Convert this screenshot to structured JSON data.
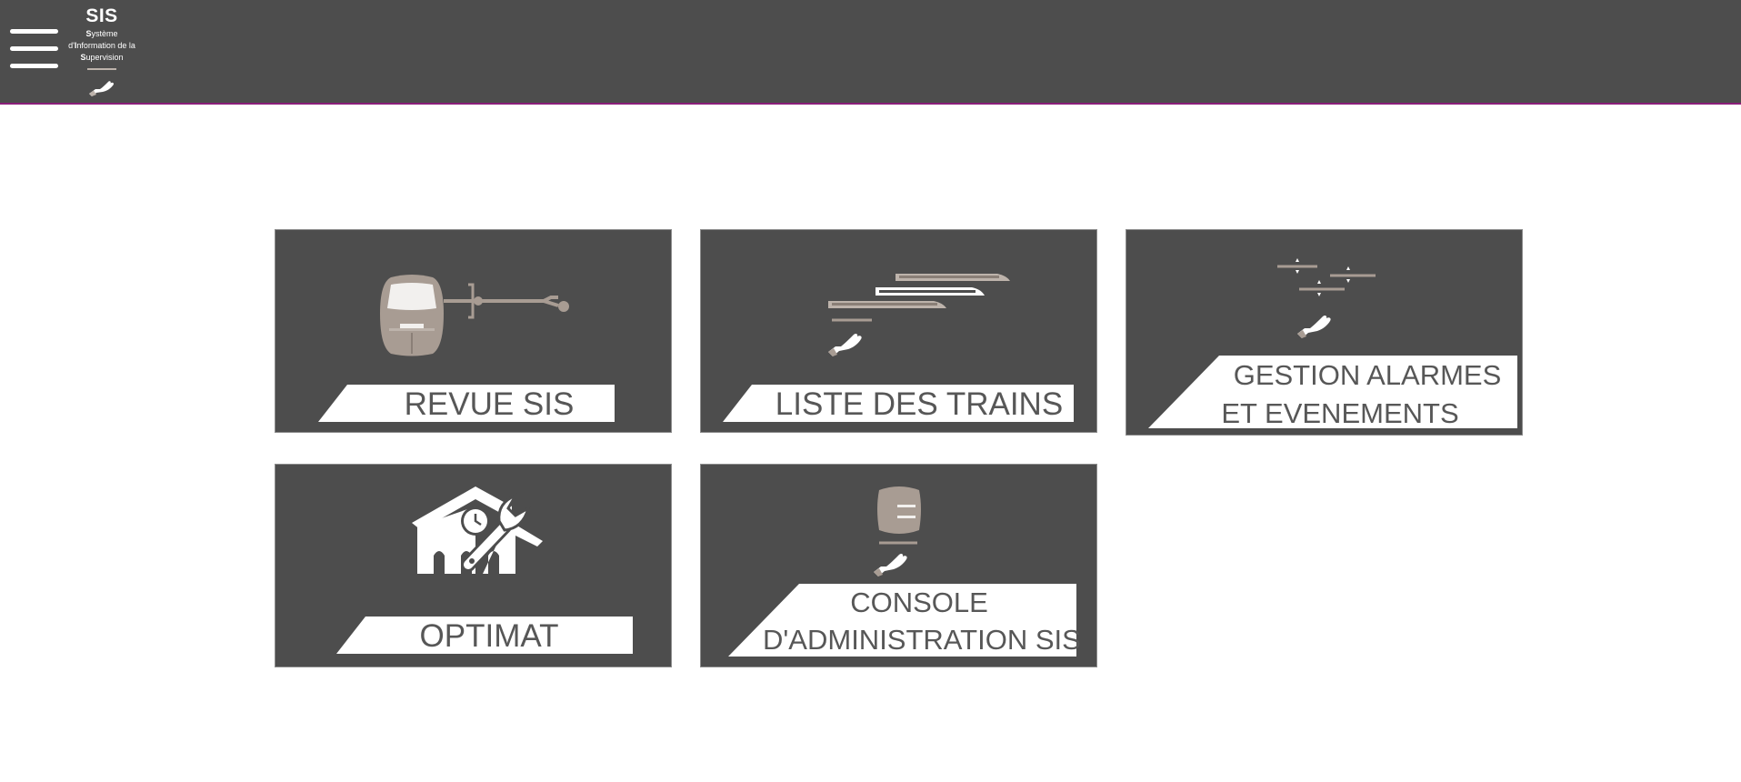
{
  "header": {
    "app_title": "SIS",
    "subtitle_line1": "ystème",
    "subtitle_line1_initial": "S",
    "subtitle_line2_prefix": "d'",
    "subtitle_line2_initial": "I",
    "subtitle_line2": "nformation de la",
    "subtitle_line3_initial": "S",
    "subtitle_line3": "upervision",
    "hand_icon": "hand-icon",
    "menu_icon": "hamburger-menu-icon"
  },
  "colors": {
    "header_bg": "#4d4d4d",
    "header_border": "#8a1f7a",
    "tile_bg": "#4d4d4d",
    "icon_beige": "#a89c93",
    "label_text": "#575757"
  },
  "tiles": [
    {
      "id": "revue-sis",
      "label_line1": "REVUE SIS",
      "label_line2": "",
      "icon": "train-track-icon"
    },
    {
      "id": "liste-des-trains",
      "label_line1": "LISTE DES TRAINS",
      "label_line2": "",
      "icon": "trains-hand-icon"
    },
    {
      "id": "gestion-alarmes",
      "label_line1": "GESTION ALARMES",
      "label_line2": "ET EVENEMENTS",
      "icon": "alarm-levels-hand-icon"
    },
    {
      "id": "optimat",
      "label_line1": "OPTIMAT",
      "label_line2": "",
      "icon": "maintenance-depot-icon"
    },
    {
      "id": "console-admin",
      "label_line1": "CONSOLE",
      "label_line2": "D'ADMINISTRATION SIS",
      "icon": "server-hand-icon"
    }
  ]
}
